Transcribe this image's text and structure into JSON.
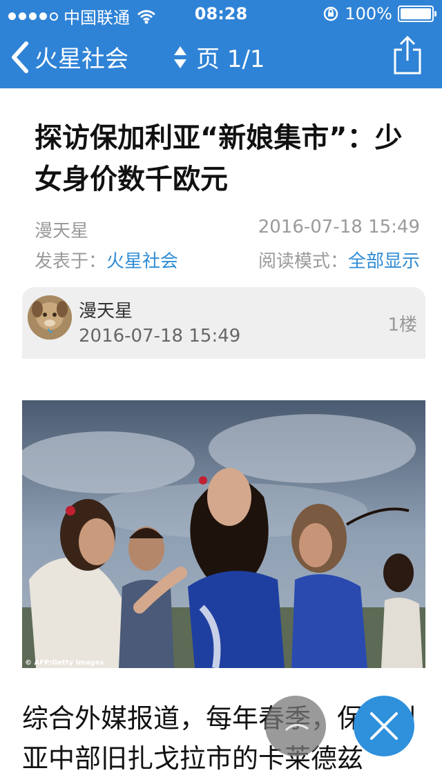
{
  "status": {
    "carrier": "中国联通",
    "time": "08:28",
    "battery": "100%"
  },
  "nav": {
    "back_label": "火星社会",
    "page_label": "页 1/1"
  },
  "article": {
    "title": "探访保加利亚“新娘集市”：少女身价数千欧元",
    "author": "漫天星",
    "date": "2016-07-18 15:49",
    "posted_in_label": "发表于：",
    "forum": "火星社会",
    "read_mode_label": "阅读模式：",
    "read_mode": "全部显示"
  },
  "post": {
    "author": "漫天星",
    "time": "2016-07-18 15:49",
    "floor": "1楼"
  },
  "photo": {
    "credit": "© AFP/Getty Images"
  },
  "body_text": "综合外媒报道，每年春季，保加利亚中部旧扎戈拉市的卡莱德兹",
  "icons": {
    "signal": "signal-dots-icon",
    "wifi": "wifi-icon",
    "lock": "rotation-lock-icon",
    "battery": "battery-icon",
    "back": "chevron-left-icon",
    "pager": "sort-arrows-icon",
    "share": "share-icon",
    "fab_gray": "leaf-icon",
    "fab_blue": "close-icon"
  },
  "colors": {
    "accent": "#2f83d6",
    "link": "#2f8bd4"
  }
}
